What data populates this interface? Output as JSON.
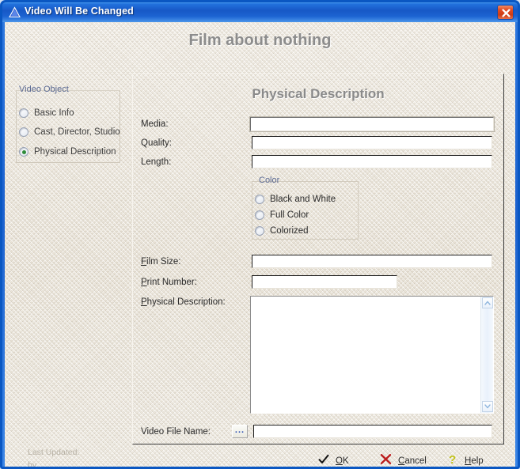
{
  "window": {
    "title": "Video Will Be Changed",
    "title_icon": "triangle-warning-icon",
    "close_label": "×",
    "accent_title_bar": "#1758c6",
    "accent_close": "#e24b22",
    "client_bg": "#ece7dd"
  },
  "header": {
    "main_title": "Film about nothing"
  },
  "sidebar": {
    "group_label": "Video Object",
    "items": [
      {
        "label": "Basic Info",
        "selected": false
      },
      {
        "label": "Cast, Director, Studio",
        "selected": false
      },
      {
        "label": "Physical Description",
        "selected": true
      }
    ]
  },
  "footer_meta": {
    "last_updated_label": "Last Updated:",
    "by_label": "by"
  },
  "panel": {
    "heading": "Physical Description",
    "fields": {
      "media": {
        "label": "Media:",
        "value": "",
        "focused": true
      },
      "quality": {
        "label": "Quality:",
        "value": "",
        "focused": false
      },
      "length": {
        "label": "Length:",
        "value": "",
        "focused": false
      },
      "film_size": {
        "label_pre": "",
        "label_accel": "F",
        "label_post": "ilm Size:",
        "value": "",
        "focused": false
      },
      "print_number": {
        "label_accel": "P",
        "label_post": "rint Number:",
        "value": "",
        "focused": false
      },
      "physical_description": {
        "label_accel": "P",
        "label_post": "hysical Description:",
        "value": ""
      },
      "video_file_name": {
        "label": "Video File Name:",
        "value": "",
        "browse_label": "..."
      }
    },
    "color_group": {
      "legend": "Color",
      "options": [
        {
          "label": "Black and White",
          "selected": false
        },
        {
          "label": "Full Color",
          "selected": false
        },
        {
          "label": "Colorized",
          "selected": false
        }
      ]
    },
    "scrollbar": {
      "up_icon": "chevron-up-icon",
      "down_icon": "chevron-down-icon"
    }
  },
  "actions": [
    {
      "name": "ok",
      "icon": "check-icon",
      "accel": "O",
      "rest": "K",
      "color": "#1a1a1a"
    },
    {
      "name": "cancel",
      "icon": "x-icon",
      "accel": "C",
      "rest": "ancel",
      "color": "#c02020"
    },
    {
      "name": "help",
      "icon": "question-mark-icon",
      "accel": "H",
      "rest": "elp",
      "color": "#b5b515"
    }
  ]
}
